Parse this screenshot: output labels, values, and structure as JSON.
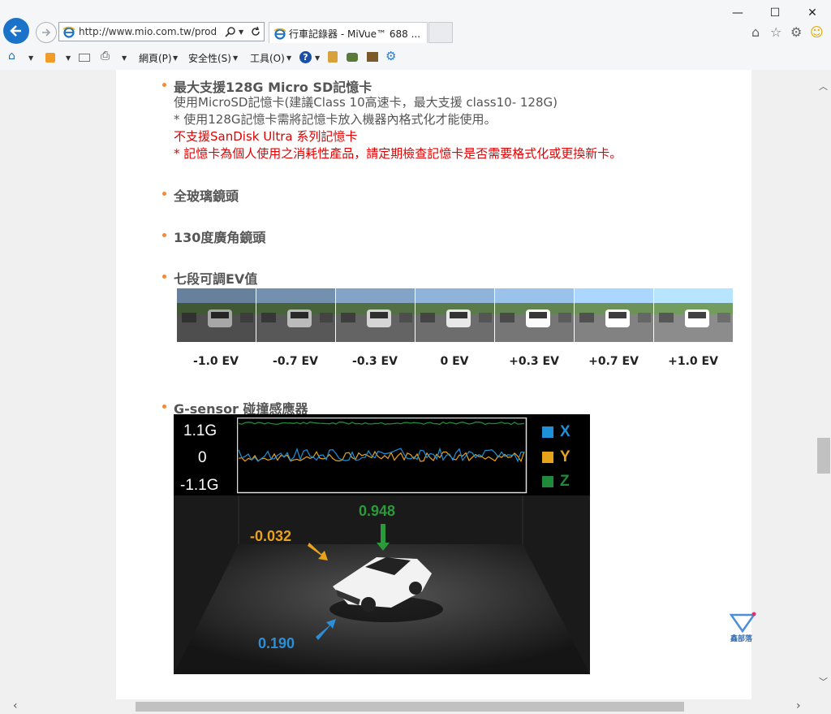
{
  "window": {
    "minimize": "—",
    "maximize": "☐",
    "close": "✕"
  },
  "nav": {
    "address": "http://www.mio.com.tw/produc",
    "tab_title": "行車記錄器 - MiVue™ 688 ..."
  },
  "commandbar": {
    "page": "網頁(P)",
    "safety": "安全性(S)",
    "tools": "工具(O)"
  },
  "features": {
    "sd": {
      "title": "最大支援128G Micro SD記憶卡",
      "line1": "使用MicroSD記憶卡(建議Class 10高速卡，最大支援 class10- 128G)",
      "line2": "* 使用128G記憶卡需將記憶卡放入機器內格式化才能使用。",
      "line3": "不支援SanDisk Ultra 系列記憶卡",
      "line4": "* 記憶卡為個人使用之消耗性產品，請定期檢查記憶卡是否需要格式化或更換新卡。"
    },
    "glass": "全玻璃鏡頭",
    "wide": "130度廣角鏡頭",
    "ev_title": "七段可調EV值",
    "ev_labels": [
      "-1.0 EV",
      "-0.7 EV",
      "-0.3 EV",
      "0 EV",
      "+0.3 EV",
      "+0.7 EV",
      "+1.0 EV"
    ],
    "ev_levels": [
      -1.0,
      -0.7,
      -0.3,
      0,
      0.3,
      0.7,
      1.0
    ],
    "gsensor_title": "G-sensor 碰撞感應器"
  },
  "gsensor": {
    "y_top": "1.1G",
    "y_mid": "0",
    "y_bot": "-1.1G",
    "legend": [
      {
        "label": "X",
        "color": "#1e90d8"
      },
      {
        "label": "Y",
        "color": "#e8a21c"
      },
      {
        "label": "Z",
        "color": "#1f8a3a"
      }
    ],
    "z_value": "0.948",
    "y_value": "-0.032",
    "x_value": "0.190"
  },
  "watermark": "鑫部落",
  "colors": {
    "accent": "#f08a3c",
    "red": "#e00000"
  }
}
